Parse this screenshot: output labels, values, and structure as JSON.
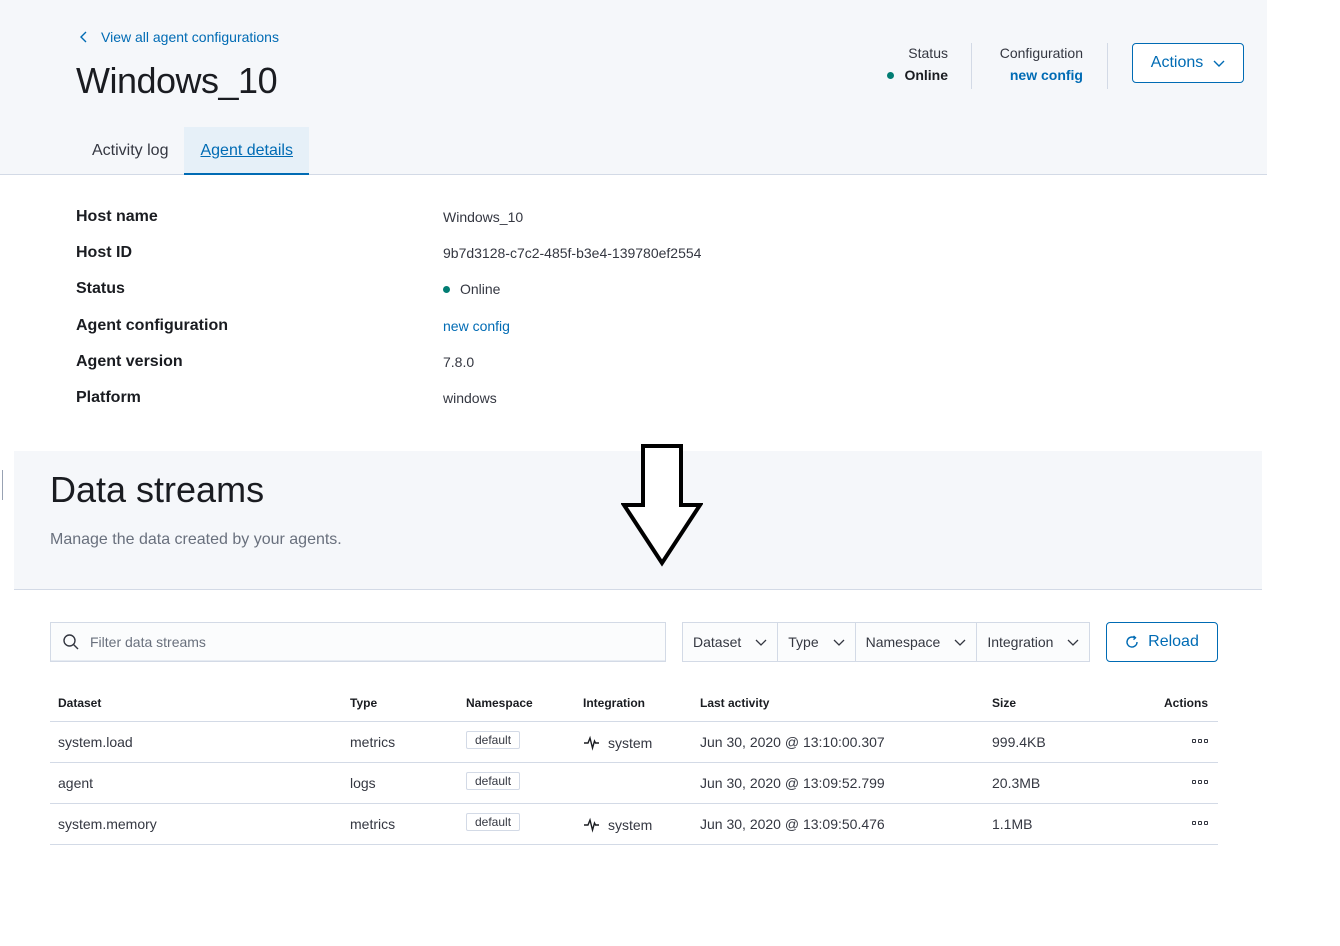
{
  "header": {
    "back_link": "View all agent configurations",
    "title": "Windows_10",
    "status_label": "Status",
    "status_value": "Online",
    "config_label": "Configuration",
    "config_value": "new config",
    "actions_label": "Actions"
  },
  "tabs": [
    {
      "label": "Activity log",
      "active": false
    },
    {
      "label": "Agent details",
      "active": true
    }
  ],
  "details": [
    {
      "key": "Host name",
      "value": "Windows_10"
    },
    {
      "key": "Host ID",
      "value": "9b7d3128-c7c2-485f-b3e4-139780ef2554"
    },
    {
      "key": "Status",
      "value": "Online"
    },
    {
      "key": "Agent configuration",
      "value": "new config"
    },
    {
      "key": "Agent version",
      "value": "7.8.0"
    },
    {
      "key": "Platform",
      "value": "windows"
    }
  ],
  "data_streams": {
    "title": "Data streams",
    "subtitle": "Manage the data created by your agents.",
    "search_placeholder": "Filter data streams",
    "filters": [
      "Dataset",
      "Type",
      "Namespace",
      "Integration"
    ],
    "reload_label": "Reload",
    "columns": [
      "Dataset",
      "Type",
      "Namespace",
      "Integration",
      "Last activity",
      "Size",
      "Actions"
    ],
    "rows": [
      {
        "dataset": "system.load",
        "type": "metrics",
        "namespace": "default",
        "integration": "system",
        "last_activity": "Jun 30, 2020 @ 13:10:00.307",
        "size": "999.4KB"
      },
      {
        "dataset": "agent",
        "type": "logs",
        "namespace": "default",
        "integration": "",
        "last_activity": "Jun 30, 2020 @ 13:09:52.799",
        "size": "20.3MB"
      },
      {
        "dataset": "system.memory",
        "type": "metrics",
        "namespace": "default",
        "integration": "system",
        "last_activity": "Jun 30, 2020 @ 13:09:50.476",
        "size": "1.1MB"
      }
    ]
  },
  "colors": {
    "accent": "#006bb4",
    "success": "#017d73",
    "header_bg": "#f5f7fa",
    "border": "#d3dae6"
  },
  "icons": {
    "back": "chevron-left-icon",
    "dropdown": "chevron-down-icon",
    "search": "search-icon",
    "reload": "refresh-icon",
    "integration": "heartbeat-icon",
    "row_actions": "more-dots-icon",
    "annotation": "down-arrow-icon"
  }
}
